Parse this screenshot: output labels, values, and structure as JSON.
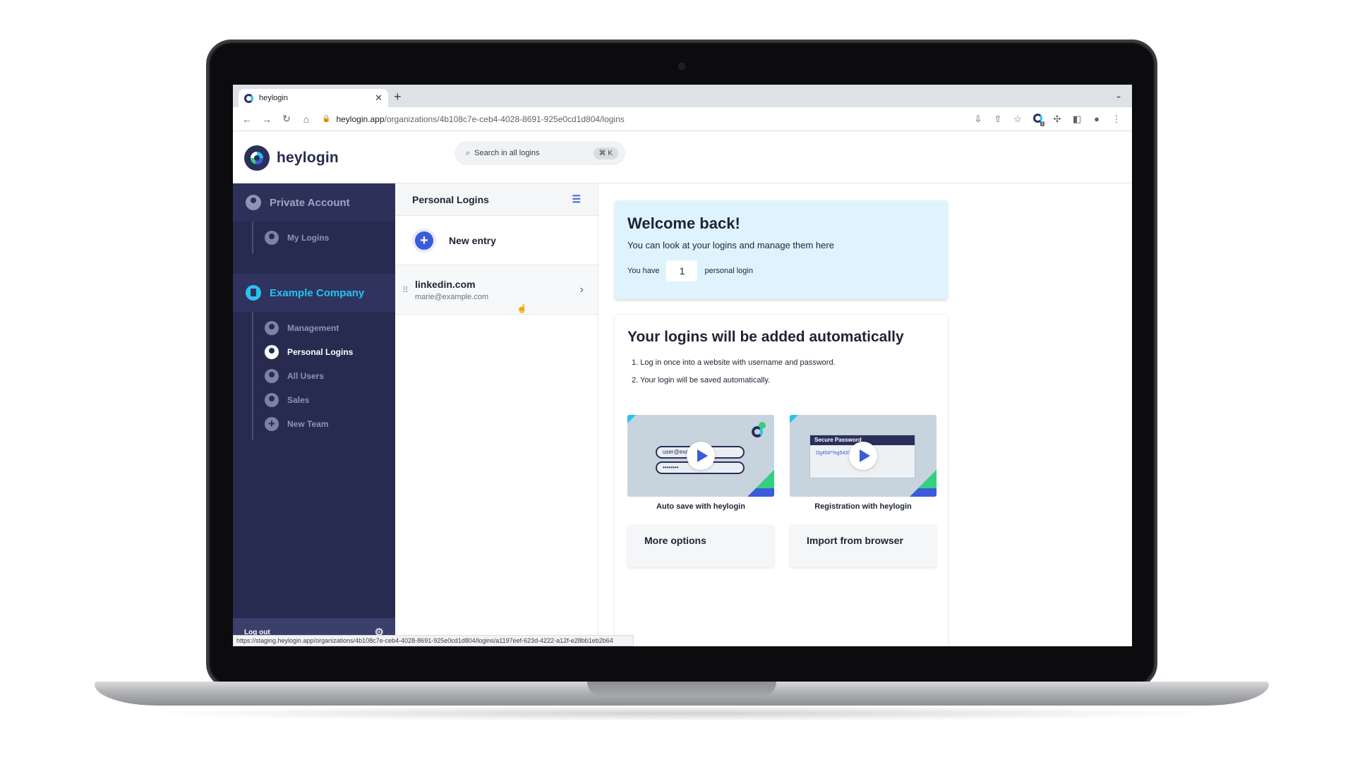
{
  "browser": {
    "tab_title": "heylogin",
    "tab_close": "✕",
    "new_tab": "+",
    "url_host": "heylogin.app",
    "url_path": "/organizations/4b108c7e-ceb4-4028-8691-925e0cd1d804/logins",
    "status_url": "https://staging.heylogin.app/organizations/4b108c7e-ceb4-4028-8691-925e0cd1d804/logins/a1197eef-623d-4222-a12f-e28bb1eb2b64",
    "extension_count": "1"
  },
  "header": {
    "brand_name": "heylogin",
    "search_placeholder": "Search in all logins",
    "search_shortcut": "⌘ K"
  },
  "sidebar": {
    "private_account": "Private Account",
    "private_items": [
      {
        "label": "My Logins"
      }
    ],
    "company_name": "Example Company",
    "company_items": [
      {
        "label": "Management"
      },
      {
        "label": "Personal Logins",
        "active": true
      },
      {
        "label": "All Users"
      },
      {
        "label": "Sales"
      },
      {
        "label": "New Team"
      }
    ],
    "logout": "Log out"
  },
  "logins": {
    "title": "Personal Logins",
    "new_entry": "New entry",
    "items": [
      {
        "site": "linkedin.com",
        "user": "marie@example.com"
      }
    ]
  },
  "welcome": {
    "title": "Welcome back!",
    "subtitle": "You can look at your logins and manage them here",
    "count_prefix": "You have",
    "count": "1",
    "count_suffix": "personal login"
  },
  "auto": {
    "title": "Your logins will be added automatically",
    "steps": [
      "1. Log in once into a website with username and password.",
      "2. Your login will be saved automatically."
    ],
    "videos": [
      {
        "caption": "Auto save with heylogin",
        "field_user": "user@exa",
        "field_pw": "••••••••"
      },
      {
        "caption": "Registration with heylogin",
        "pw_title": "Secure Password",
        "pw_value": "Dg45#*%g5437"
      }
    ],
    "more_options": "More options",
    "import_browser": "Import from browser"
  },
  "colors": {
    "sidebar_bg": "#272b4f",
    "accent": "#3b5bdb",
    "company_accent": "#27c3f0",
    "welcome_bg": "#dff3fd"
  }
}
